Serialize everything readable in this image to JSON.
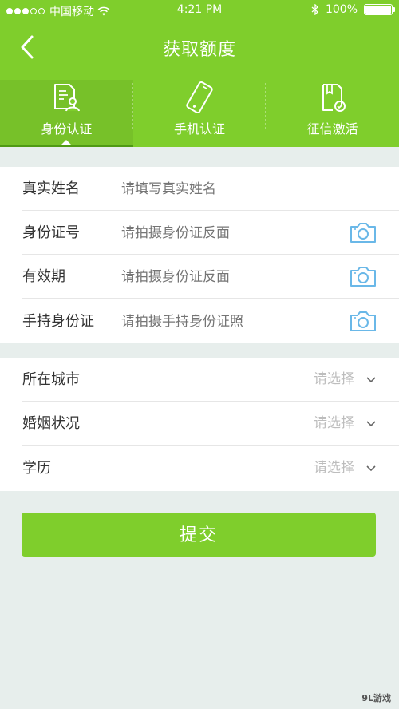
{
  "status_bar": {
    "carrier": "中国移动",
    "time": "4:21 PM",
    "battery": "100%",
    "battery_level": 1.0,
    "signal_dots_filled": 3
  },
  "header": {
    "title": "获取额度",
    "accent_color": "#7fce2c"
  },
  "tabs": [
    {
      "label": "身份认证",
      "icon": "id-document-icon",
      "active": true
    },
    {
      "label": "手机认证",
      "icon": "mobile-phone-icon",
      "active": false
    },
    {
      "label": "征信激活",
      "icon": "credit-report-icon",
      "active": false
    }
  ],
  "identity_form": {
    "name": {
      "label": "真实姓名",
      "placeholder": "请填写真实姓名"
    },
    "id_number": {
      "label": "身份证号",
      "placeholder": "请拍摄身份证反面"
    },
    "validity": {
      "label": "有效期",
      "placeholder": "请拍摄身份证反面"
    },
    "handheld_id": {
      "label": "手持身份证",
      "placeholder": "请拍摄手持身份证照"
    }
  },
  "profile_form": {
    "city": {
      "label": "所在城市",
      "value": "请选择"
    },
    "marital_status": {
      "label": "婚姻状况",
      "value": "请选择"
    },
    "education": {
      "label": "学历",
      "value": "请选择"
    }
  },
  "submit_label": "提交",
  "watermark": "9L游戏"
}
